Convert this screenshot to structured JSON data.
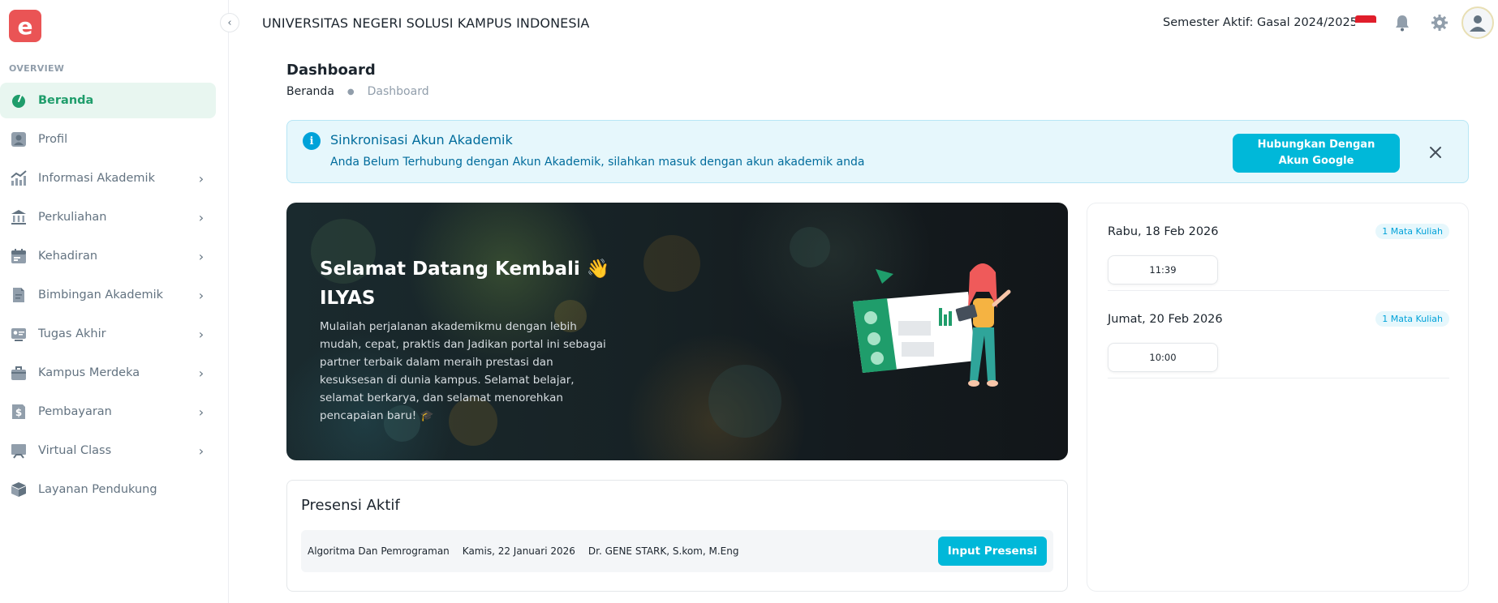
{
  "app": {
    "logo_letter": "e",
    "university": "UNIVERSITAS NEGERI SOLUSI KAMPUS INDONESIA",
    "semester": "Semester Aktif: Gasal 2024/2025"
  },
  "sidebar": {
    "section_label": "OVERVIEW",
    "items": [
      {
        "label": "Beranda",
        "icon": "dashboard-icon",
        "active": true,
        "has_children": false
      },
      {
        "label": "Profil",
        "icon": "user-icon",
        "active": false,
        "has_children": false
      },
      {
        "label": "Informasi Akademik",
        "icon": "chart-icon",
        "active": false,
        "has_children": true
      },
      {
        "label": "Perkuliahan",
        "icon": "institution-icon",
        "active": false,
        "has_children": true
      },
      {
        "label": "Kehadiran",
        "icon": "calendar-icon",
        "active": false,
        "has_children": true
      },
      {
        "label": "Bimbingan Akademik",
        "icon": "document-icon",
        "active": false,
        "has_children": true
      },
      {
        "label": "Tugas Akhir",
        "icon": "id-card-icon",
        "active": false,
        "has_children": true
      },
      {
        "label": "Kampus Merdeka",
        "icon": "briefcase-icon",
        "active": false,
        "has_children": true
      },
      {
        "label": "Pembayaran",
        "icon": "invoice-icon",
        "active": false,
        "has_children": true
      },
      {
        "label": "Virtual Class",
        "icon": "board-icon",
        "active": false,
        "has_children": true
      },
      {
        "label": "Layanan Pendukung",
        "icon": "box-icon",
        "active": false,
        "has_children": false
      }
    ]
  },
  "page": {
    "title": "Dashboard",
    "breadcrumb": [
      "Beranda",
      "Dashboard"
    ]
  },
  "alert": {
    "title": "Sinkronisasi Akun Akademik",
    "description": "Anda Belum Terhubung dengan Akun Akademik, silahkan masuk dengan akun akademik anda",
    "button_label": "Hubungkan Dengan Akun Google"
  },
  "welcome": {
    "title_line1": "Selamat Datang Kembali 👋",
    "title_line2": "ILYAS",
    "description": "Mulailah perjalanan akademikmu dengan lebih mudah, cepat, praktis dan Jadikan portal ini sebagai partner terbaik dalam meraih prestasi dan kesuksesan di dunia kampus. Selamat belajar, selamat berkarya, dan selamat menorehkan pencapaian baru! 🎓"
  },
  "schedule": [
    {
      "date": "Rabu, 18 Feb 2026",
      "badge": "1 Mata Kuliah",
      "time": "11:39"
    },
    {
      "date": "Jumat, 20 Feb 2026",
      "badge": "1 Mata Kuliah",
      "time": "10:00"
    }
  ],
  "presensi": {
    "title": "Presensi Aktif",
    "row": {
      "course": "Algoritma Dan Pemrograman",
      "date": "Kamis, 22 Januari 2026",
      "lecturer": "Dr. GENE STARK, S.kom, M.Eng",
      "button_label": "Input Presensi"
    }
  },
  "colors": {
    "accent_green": "#1f9d6b",
    "accent_cyan": "#00b8d9",
    "logo_red": "#ea5455"
  }
}
